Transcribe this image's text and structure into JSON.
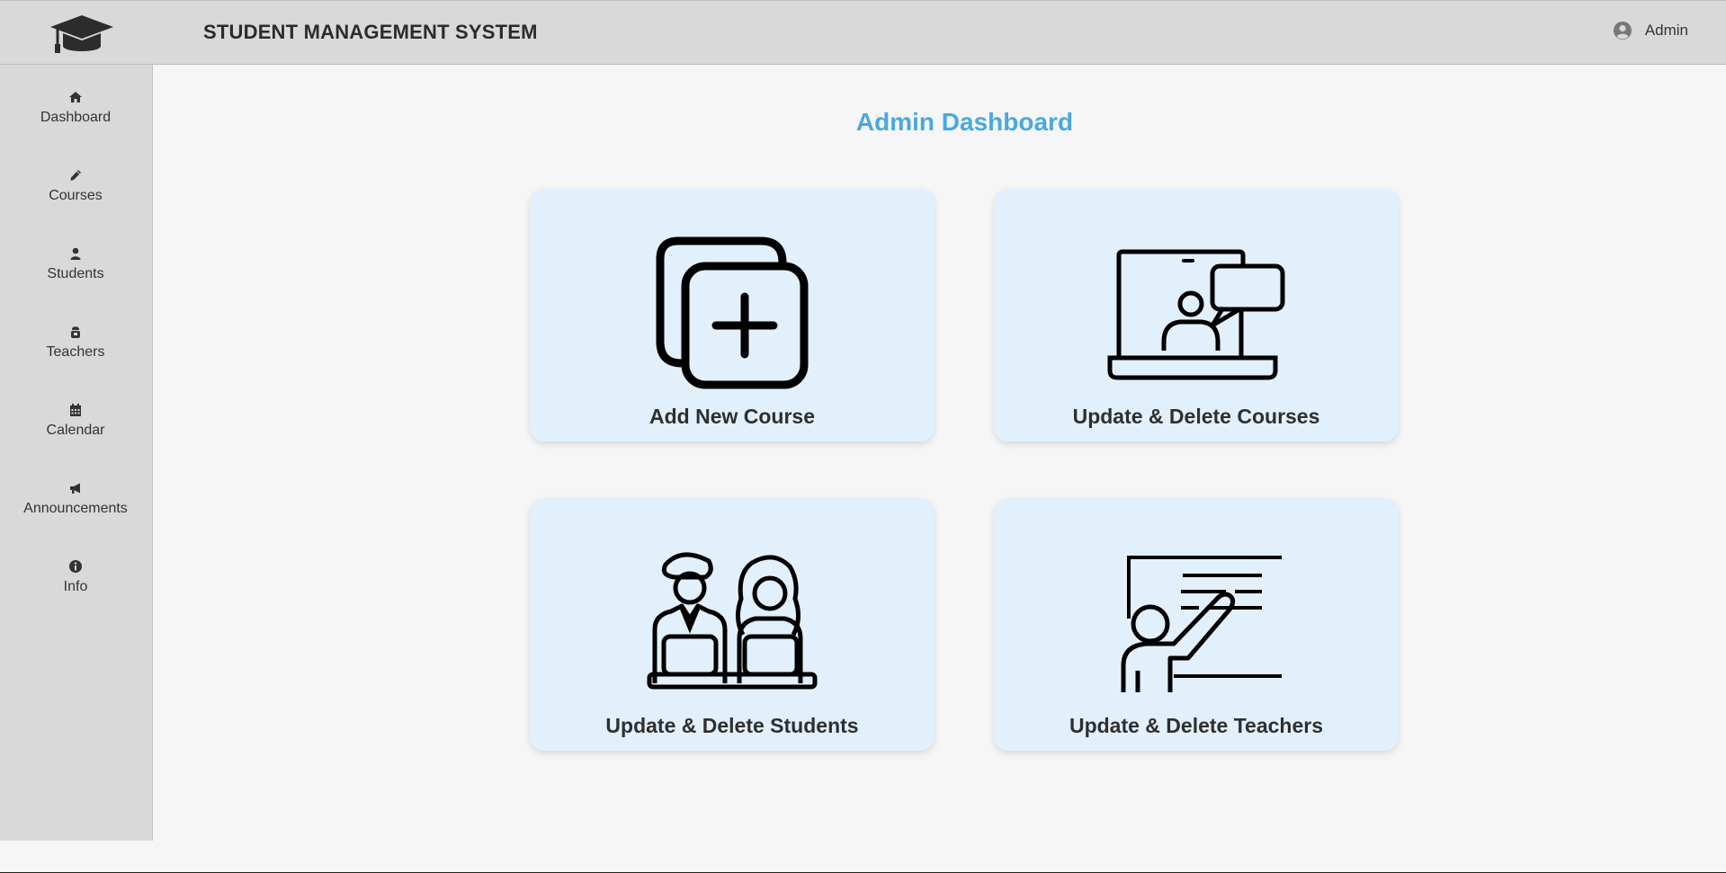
{
  "header": {
    "app_title": "STUDENT MANAGEMENT SYSTEM",
    "logo_icon": "graduation-cap-icon",
    "user": {
      "icon": "user-circle-icon",
      "name": "Admin"
    }
  },
  "sidebar": {
    "items": [
      {
        "label": "Dashboard",
        "icon": "home-icon"
      },
      {
        "label": "Courses",
        "icon": "pencil-icon"
      },
      {
        "label": "Students",
        "icon": "user-icon"
      },
      {
        "label": "Teachers",
        "icon": "teacher-icon"
      },
      {
        "label": "Calendar",
        "icon": "calendar-icon"
      },
      {
        "label": "Announcements",
        "icon": "megaphone-icon"
      },
      {
        "label": "Info",
        "icon": "info-icon"
      }
    ]
  },
  "main": {
    "title": "Admin Dashboard",
    "cards": [
      {
        "label": "Add New Course",
        "icon": "add-course-icon"
      },
      {
        "label": "Update & Delete Courses",
        "icon": "laptop-lecture-icon"
      },
      {
        "label": "Update & Delete Students",
        "icon": "students-icon"
      },
      {
        "label": "Update & Delete Teachers",
        "icon": "teacher-whiteboard-icon"
      }
    ]
  },
  "colors": {
    "header_bg": "#d9d9d9",
    "sidebar_bg": "#d9d9d9",
    "page_bg": "#f6f6f6",
    "card_bg": "#e2f0fc",
    "title_accent": "#4aa8e0"
  }
}
